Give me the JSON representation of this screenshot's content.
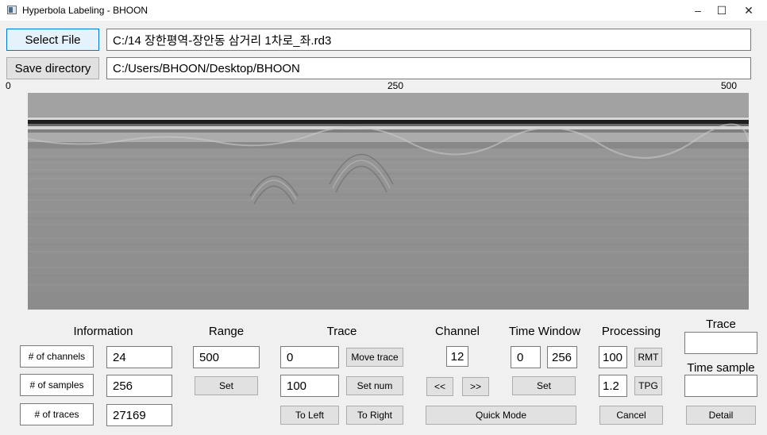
{
  "window": {
    "title": "Hyperbola Labeling - BHOON",
    "minimize": "–",
    "maximize": "☐",
    "close": "✕"
  },
  "file": {
    "select_label": "Select File",
    "path": "C:/14 장한평역-장안동 삼거리 1차로_좌.rd3"
  },
  "save": {
    "label": "Save directory",
    "path": "C:/Users/BHOON/Desktop/BHOON"
  },
  "ruler": {
    "start": "0",
    "mid": "250",
    "end": "500"
  },
  "information": {
    "header": "Information",
    "channels_label": "# of channels",
    "channels_value": "24",
    "samples_label": "# of samples",
    "samples_value": "256",
    "traces_label": "# of traces",
    "traces_value": "27169"
  },
  "range": {
    "header": "Range",
    "value": "500",
    "set_label": "Set"
  },
  "trace": {
    "header": "Trace",
    "start_value": "0",
    "move_label": "Move trace",
    "num_value": "100",
    "set_num_label": "Set num",
    "left_label": "To Left",
    "right_label": "To Right"
  },
  "channel": {
    "header": "Channel",
    "value": "12",
    "prev_label": "<<",
    "next_label": ">>"
  },
  "time_window": {
    "header": "Time Window",
    "from": "0",
    "to": "256",
    "set_label": "Set"
  },
  "quick_mode_label": "Quick Mode",
  "processing": {
    "header": "Processing",
    "rmt_value": "100",
    "rmt_label": "RMT",
    "tpg_value": "1.2",
    "tpg_label": "TPG",
    "cancel_label": "Cancel"
  },
  "side": {
    "trace_label": "Trace",
    "trace_value": "",
    "time_sample_label": "Time sample",
    "time_sample_value": "",
    "detail_label": "Detail"
  },
  "colors": {
    "accent": "#0078d7",
    "button": "#e1e1e1",
    "primary_button": "#e5f1fb"
  }
}
